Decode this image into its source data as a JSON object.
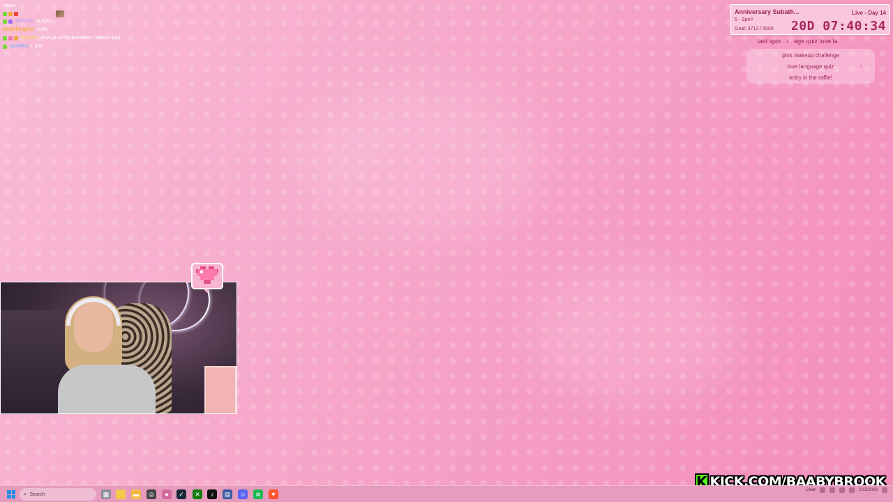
{
  "chat": {
    "lines": [
      {
        "user": "",
        "text": "retard"
      },
      {
        "user": "",
        "text": ""
      },
      {
        "user": "helmets",
        "text": "w topic",
        "color": "#c89ef7"
      },
      {
        "user": "deathkinglive",
        "text": "Hello",
        "color": "#f7b33f"
      },
      {
        "user": "Roseku",
        "text": "thats a whole pokemon i looked it up",
        "color": "#f7d27a"
      },
      {
        "user": "mckifen",
        "text": "L jew",
        "color": "#8ab4ff"
      }
    ]
  },
  "subathon": {
    "title": "Anniversary Subath...",
    "day": "Live - Day 14",
    "line": "5 - Spin!",
    "goal": "Goal: 3713 / 5000",
    "timer": "20D 07:40:34"
  },
  "ticker": {
    "left": "last spin",
    "right": "age quiz love la"
  },
  "wheel": {
    "items": [
      "pink makeup challenge",
      "love language quiz",
      "entry in the raffle!"
    ]
  },
  "taskbar": {
    "search_placeholder": "Search",
    "weather": "Clear",
    "time": "",
    "date": "2/15/2026"
  },
  "branding": {
    "kick_url": "KICK.COM/BAABYBROOK",
    "kick_letter": "K",
    "kick_color": "#53fc18"
  },
  "colors": {
    "accent": "#9c2459",
    "background": "#f6a9cb"
  }
}
